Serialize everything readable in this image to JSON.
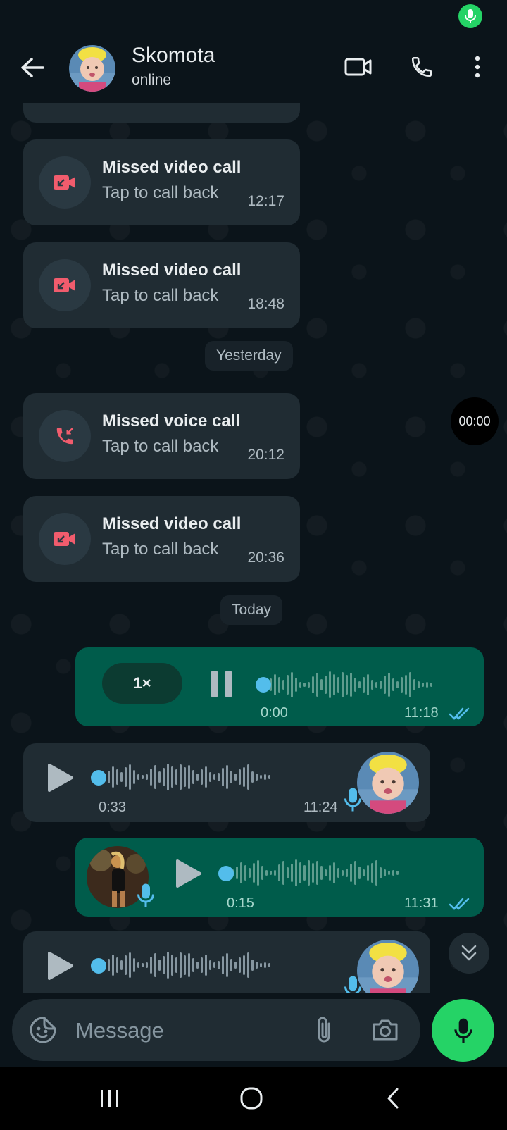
{
  "header": {
    "contact_name": "Skomota",
    "status": "online"
  },
  "messages": [
    {
      "type": "missed_video",
      "title": "Missed video call",
      "subtitle": "Tap to call back",
      "time": "12:17"
    },
    {
      "type": "missed_video",
      "title": "Missed video call",
      "subtitle": "Tap to call back",
      "time": "18:48"
    },
    {
      "type": "date",
      "label": "Yesterday"
    },
    {
      "type": "missed_voice",
      "title": "Missed voice call",
      "subtitle": "Tap to call back",
      "time": "20:12"
    },
    {
      "type": "missed_video",
      "title": "Missed video call",
      "subtitle": "Tap to call back",
      "time": "20:36"
    },
    {
      "type": "date",
      "label": "Today"
    },
    {
      "type": "voice_out",
      "speed": "1×",
      "position": "0:00",
      "time": "11:18",
      "playing": true
    },
    {
      "type": "voice_in",
      "duration": "0:33",
      "time": "11:24"
    },
    {
      "type": "voice_out",
      "duration": "0:15",
      "time": "11:31"
    },
    {
      "type": "voice_in_partial"
    }
  ],
  "recording_timer": "00:00",
  "composer": {
    "placeholder": "Message"
  },
  "colors": {
    "accent_green": "#25d366",
    "outgoing_bubble": "#005c4b",
    "incoming_bubble": "#202c33",
    "missed_call_red": "#f15c6d",
    "progress_blue": "#53bdeb",
    "background": "#0b141a"
  },
  "icons": [
    "back-arrow-icon",
    "video-call-icon",
    "voice-call-icon",
    "more-options-icon",
    "missed-video-call-icon",
    "missed-voice-call-icon",
    "pause-icon",
    "play-icon",
    "mic-icon",
    "double-check-icon",
    "scroll-down-icon",
    "sticker-icon",
    "attach-icon",
    "camera-icon"
  ]
}
